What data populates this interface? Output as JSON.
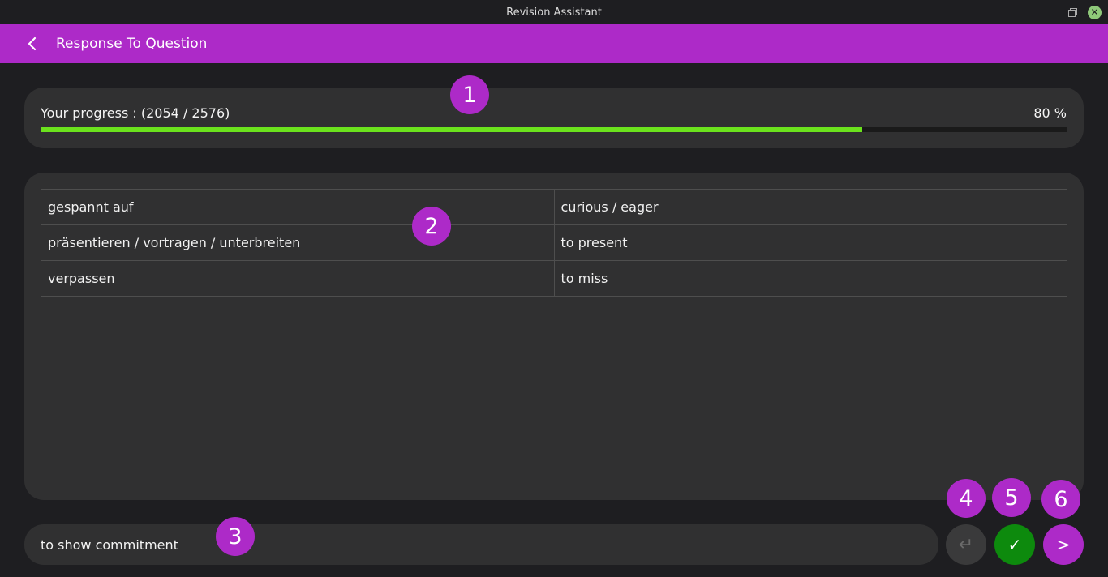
{
  "window": {
    "title": "Revision Assistant",
    "close_glyph": "✕"
  },
  "appbar": {
    "title": "Response To Question",
    "back_icon": "chevron-left-icon",
    "color": "#ad2ac8"
  },
  "progress": {
    "label": "Your progress : (2054 / 2576)",
    "percent_text": "80 %",
    "fraction": 0.8,
    "bar_color": "#6be21d"
  },
  "vocab_table": {
    "rows": [
      {
        "german": "gespannt auf",
        "english": "curious / eager"
      },
      {
        "german": "präsentieren / vortragen / unterbreiten",
        "english": "to present"
      },
      {
        "german": "verpassen",
        "english": "to miss"
      }
    ]
  },
  "answer": {
    "value": "to show commitment"
  },
  "buttons": {
    "return_glyph": "↵",
    "check_glyph": "✓",
    "next_glyph": ">",
    "check_color": "#0d8a0d",
    "next_color": "#ad2ac8"
  },
  "markers": [
    "1",
    "2",
    "3",
    "4",
    "5",
    "6"
  ]
}
